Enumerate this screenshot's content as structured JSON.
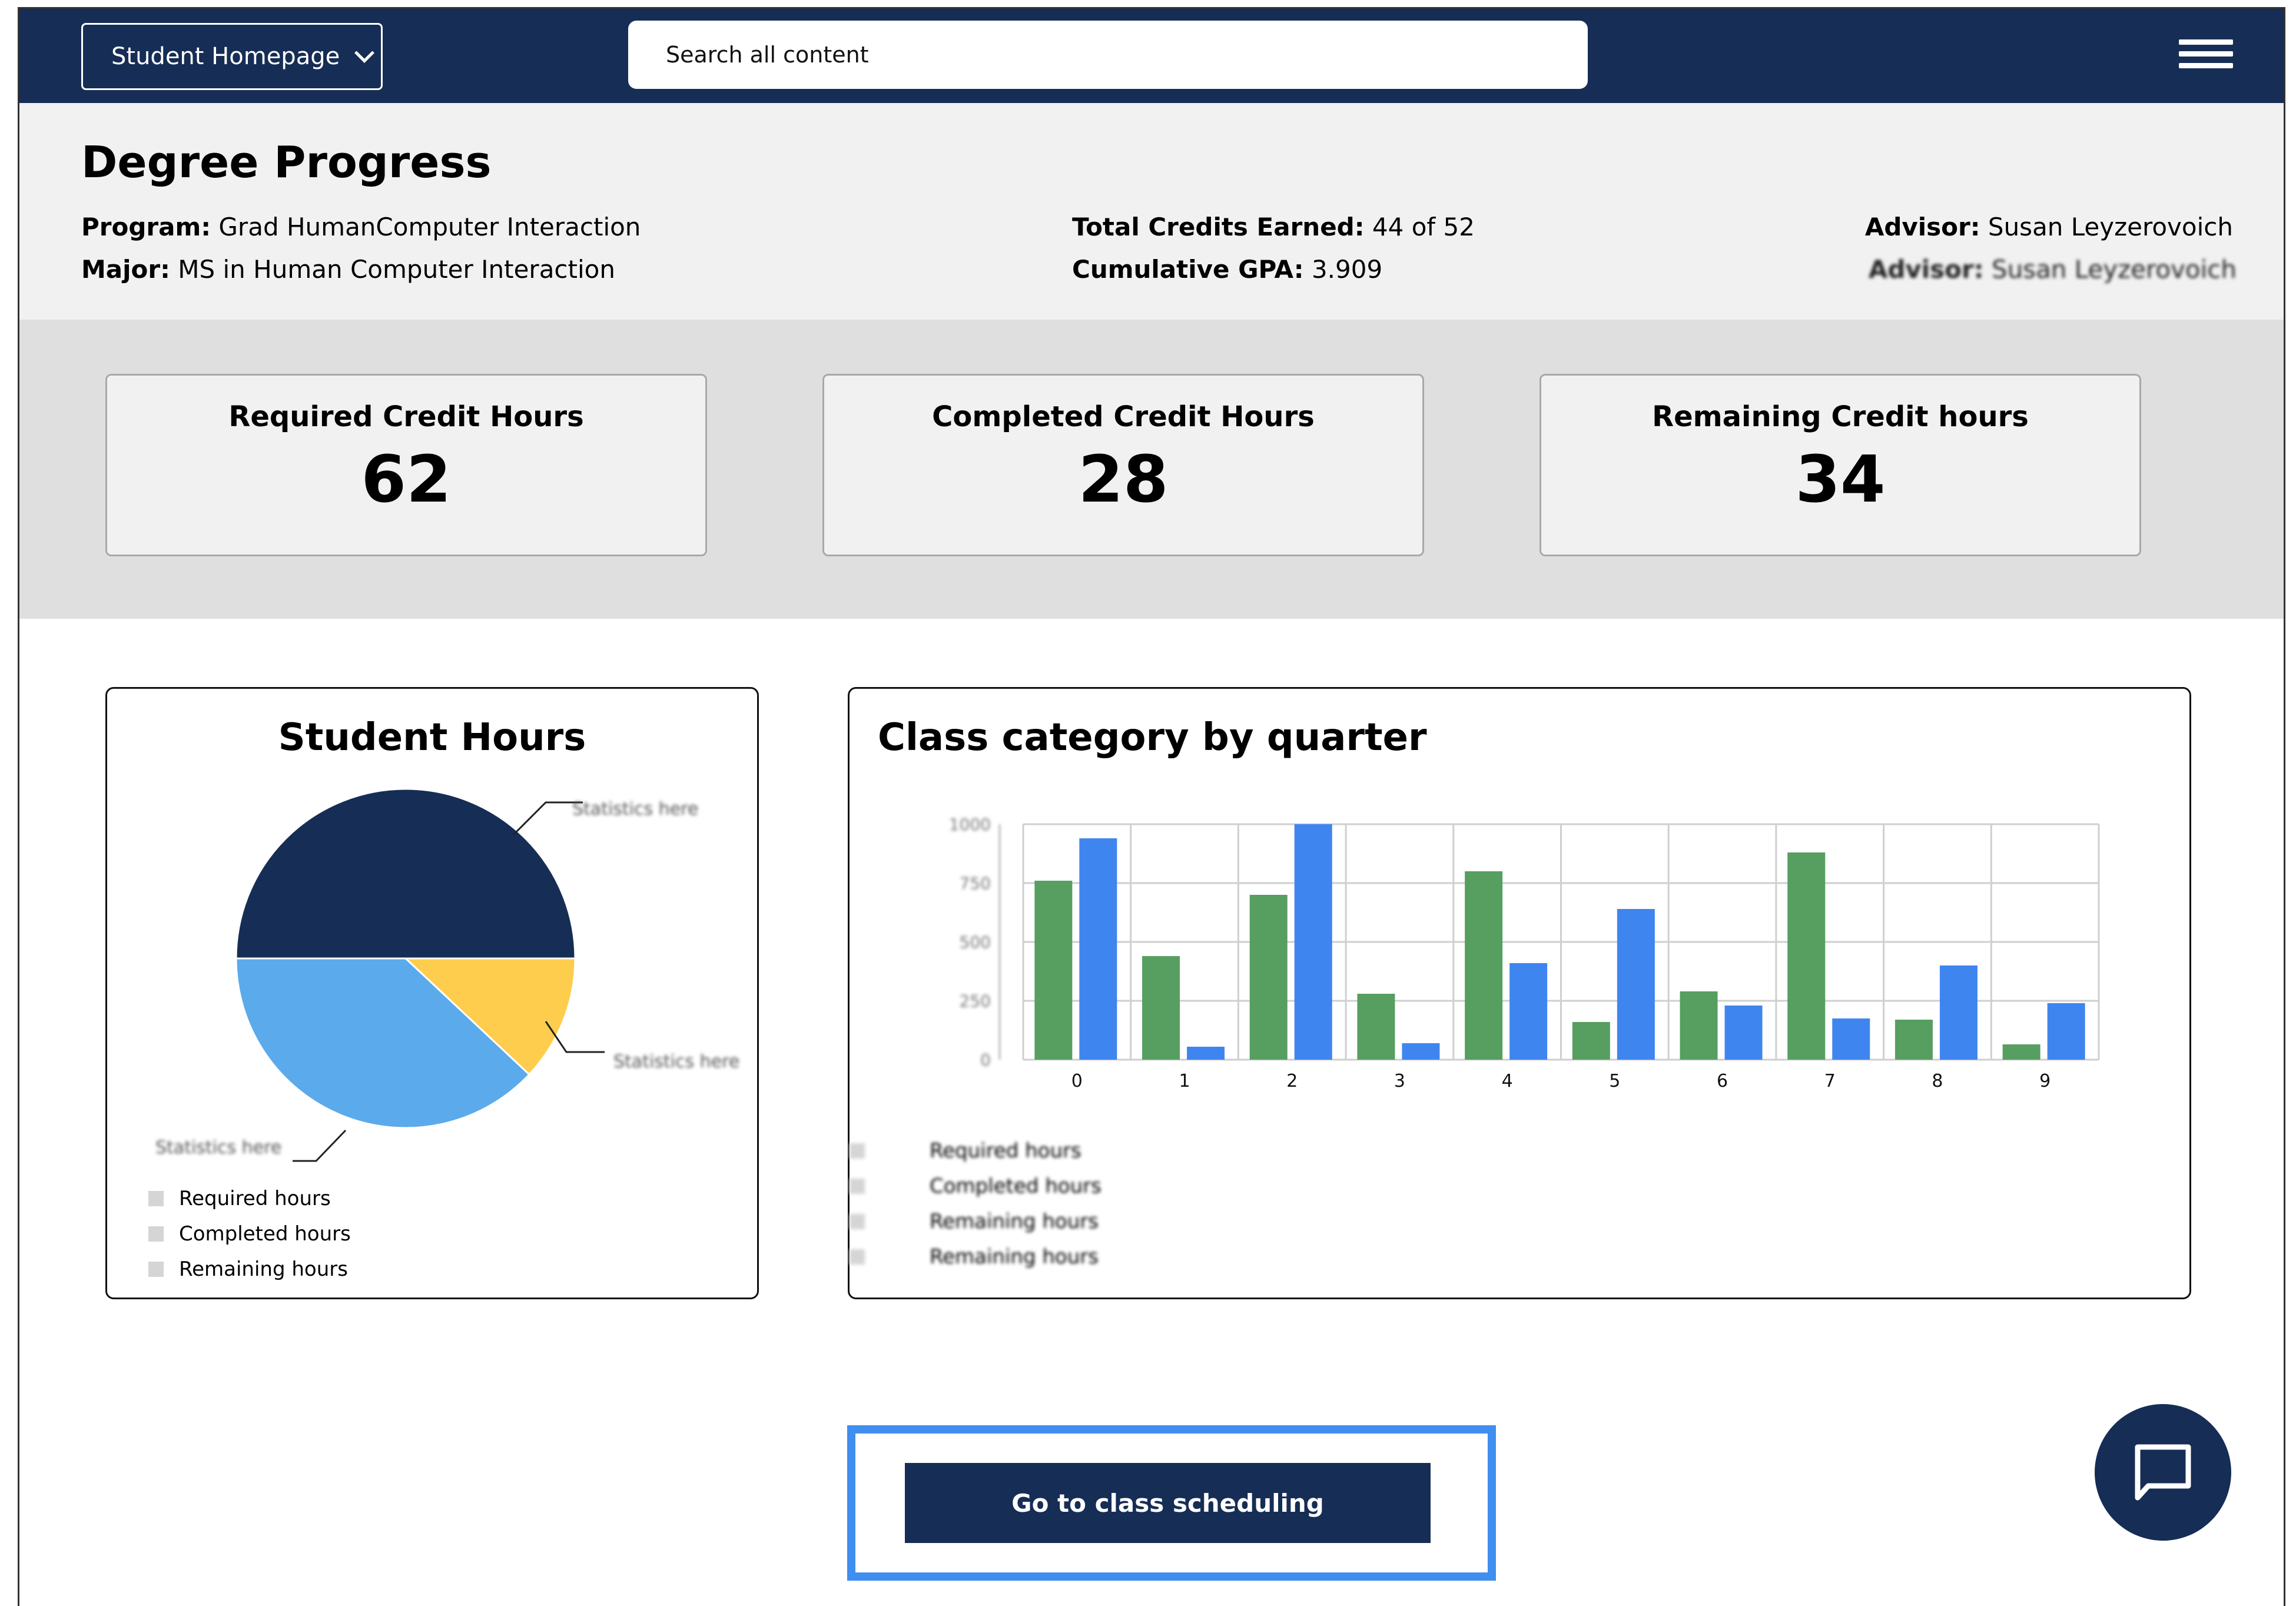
{
  "header": {
    "home_select": "Student Homepage",
    "search_placeholder": "Search all content"
  },
  "degree": {
    "title": "Degree Progress",
    "program_label": "Program:",
    "program_value": "Grad HumanComputer Interaction",
    "major_label": "Major:",
    "major_value": "MS in Human Computer Interaction",
    "credits_label": "Total Credits Earned:",
    "credits_value": "44 of 52",
    "gpa_label": "Cumulative GPA:",
    "gpa_value": "3.909",
    "advisor_label": "Advisor:",
    "advisor_value": "Susan Leyzerovoich",
    "advisor2_label": "Advisor:",
    "advisor2_value": "Susan Leyzerovoich"
  },
  "stats": [
    {
      "label": "Required Credit Hours",
      "value": "62"
    },
    {
      "label": "Completed Credit Hours",
      "value": "28"
    },
    {
      "label": "Remaining Credit hours",
      "value": "34"
    }
  ],
  "pie_card": {
    "title": "Student Hours",
    "callouts": [
      "Statistics here",
      "Statistics here",
      "Statistics here"
    ],
    "legend": [
      "Required hours",
      "Completed hours",
      "Remaining hours"
    ]
  },
  "bar_card": {
    "title": "Class category by quarter",
    "legend": [
      "Required hours",
      "Completed hours",
      "Remaining hours",
      "Remaining hours"
    ]
  },
  "chart_data": [
    {
      "type": "pie",
      "title": "Student Hours",
      "slices": [
        {
          "label": "Statistics here",
          "value": 0.5,
          "color": "#162d55"
        },
        {
          "label": "Statistics here",
          "value": 0.12,
          "color": "#ffcd4d"
        },
        {
          "label": "Statistics here",
          "value": 0.38,
          "color": "#5baaeb"
        }
      ],
      "legend": [
        "Required hours",
        "Completed hours",
        "Remaining hours"
      ]
    },
    {
      "type": "bar",
      "title": "Class category by quarter",
      "categories": [
        "0",
        "1",
        "2",
        "3",
        "4",
        "5",
        "6",
        "7",
        "8",
        "9"
      ],
      "series": [
        {
          "values": [
            760,
            440,
            700,
            280,
            800,
            160,
            290,
            880,
            170,
            65
          ],
          "color": "#579e61"
        },
        {
          "values": [
            940,
            55,
            1000,
            70,
            410,
            640,
            230,
            175,
            400,
            240
          ],
          "color": "#3f85ef"
        }
      ],
      "ylim": [
        0,
        1000
      ],
      "yticks": [
        "0",
        "250",
        "500",
        "750",
        "1000"
      ],
      "grid": true
    }
  ],
  "cta": {
    "label": "Go to class scheduling"
  },
  "colors": {
    "navy": "#162d55",
    "highlight": "#3f8ef0"
  }
}
